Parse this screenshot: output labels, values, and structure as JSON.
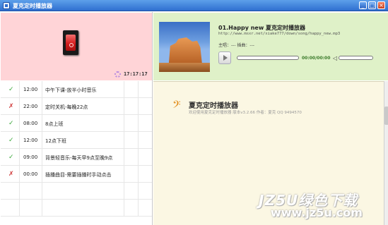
{
  "window": {
    "title": "夏克定时播放器",
    "min_label": "_",
    "max_label": "□",
    "close_label": "×"
  },
  "clock": {
    "time": "17:17:17"
  },
  "tasks": [
    {
      "status": "enabled",
      "mark": "✓",
      "time": "12:00",
      "text": "中午下课-放半小时音乐"
    },
    {
      "status": "disabled",
      "mark": "✗",
      "time": "22:00",
      "text": "定时关机-每晚22点"
    },
    {
      "status": "enabled",
      "mark": "✓",
      "time": "08:00",
      "text": "8点上班"
    },
    {
      "status": "enabled",
      "mark": "✓",
      "time": "12:00",
      "text": "12点下班"
    },
    {
      "status": "enabled",
      "mark": "✓",
      "time": "09:00",
      "text": "背景轻音乐-每天早9点至晚9点"
    },
    {
      "status": "disabled",
      "mark": "✗",
      "time": "00:00",
      "text": "插播曲目-需要插播时手动点击"
    }
  ],
  "player": {
    "song_title": "01.Happy new 夏克定时播放器",
    "song_url": "http://www.msxr.net/xiake777/down/song/happy_new.mp3",
    "singer_line": "主唱：---   插曲：---",
    "time_display": "00:00/00:00",
    "speaker_icon": "◁"
  },
  "about": {
    "app_name": "夏克定时播放器",
    "welcome": "欢迎使用夏克定时播放器  版本v3.2.66  作者：夏克  QQ 9494570"
  },
  "watermark": {
    "line1": "JZ5U绿色下载",
    "line2": "www.jz5u.com"
  },
  "colors": {
    "clock_panel_bg": "#ffd4d7",
    "player_panel_bg": "#dff1c8",
    "info_panel_bg": "#fbf7e3",
    "enabled_mark": "#3aa83a",
    "disabled_mark": "#d03a3a"
  }
}
